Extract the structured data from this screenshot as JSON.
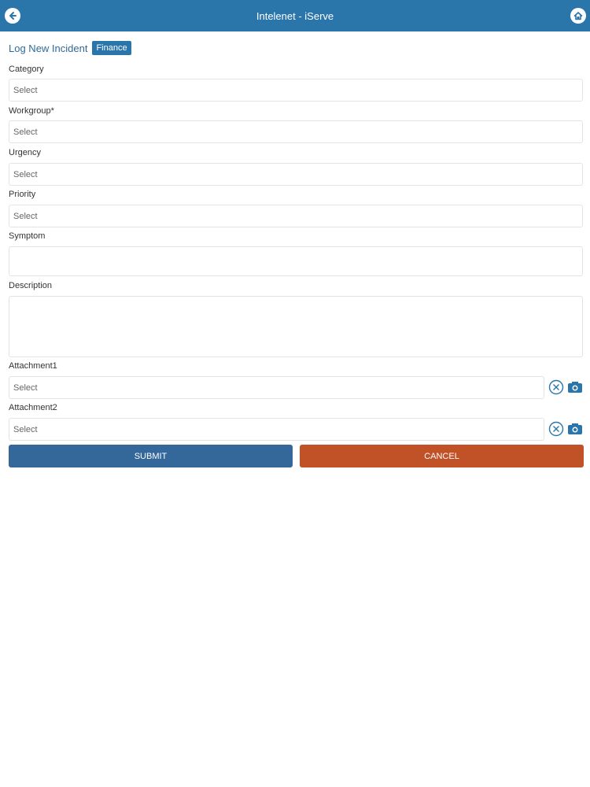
{
  "header": {
    "title": "Intelenet - iServe"
  },
  "page": {
    "title": "Log New Incident",
    "badge": "Finance"
  },
  "form": {
    "category": {
      "label": "Category",
      "value": "Select"
    },
    "workgroup": {
      "label": "Workgroup*",
      "value": "Select"
    },
    "urgency": {
      "label": "Urgency",
      "value": "Select"
    },
    "priority": {
      "label": "Priority",
      "value": "Select"
    },
    "symptom": {
      "label": "Symptom",
      "value": ""
    },
    "description": {
      "label": "Description",
      "value": ""
    },
    "attachment1": {
      "label": "Attachment1",
      "value": "Select"
    },
    "attachment2": {
      "label": "Attachment2",
      "value": "Select"
    }
  },
  "actions": {
    "submit": "SUBMIT",
    "cancel": "CANCEL"
  },
  "colors": {
    "primary": "#2a76ab",
    "submit": "#34679a",
    "cancel": "#c15227"
  }
}
